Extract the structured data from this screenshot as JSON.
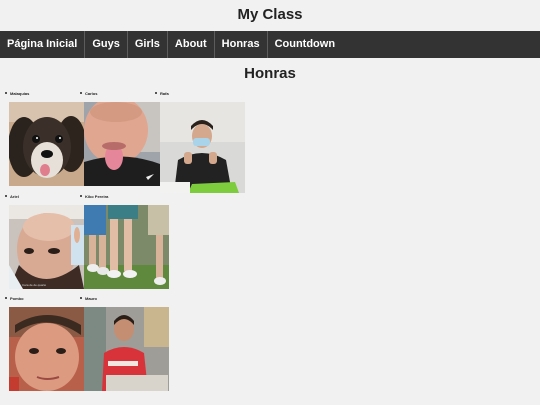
{
  "header": {
    "title": "My Class"
  },
  "nav": {
    "items": [
      {
        "label": "Página Inicial"
      },
      {
        "label": "Guys"
      },
      {
        "label": "Girls"
      },
      {
        "label": "About"
      },
      {
        "label": "Honras"
      },
      {
        "label": "Countdown"
      }
    ]
  },
  "section": {
    "title": "Honras"
  },
  "members": [
    {
      "name": "Malaquias"
    },
    {
      "name": "Carlos"
    },
    {
      "name": "Rafa"
    },
    {
      "name": "Ariel"
    },
    {
      "name": "Kiko Pereira"
    },
    {
      "name": "Pombo"
    },
    {
      "name": "Mauro"
    }
  ],
  "photo_captions": {
    "ariel": "Cara de de quarto"
  }
}
